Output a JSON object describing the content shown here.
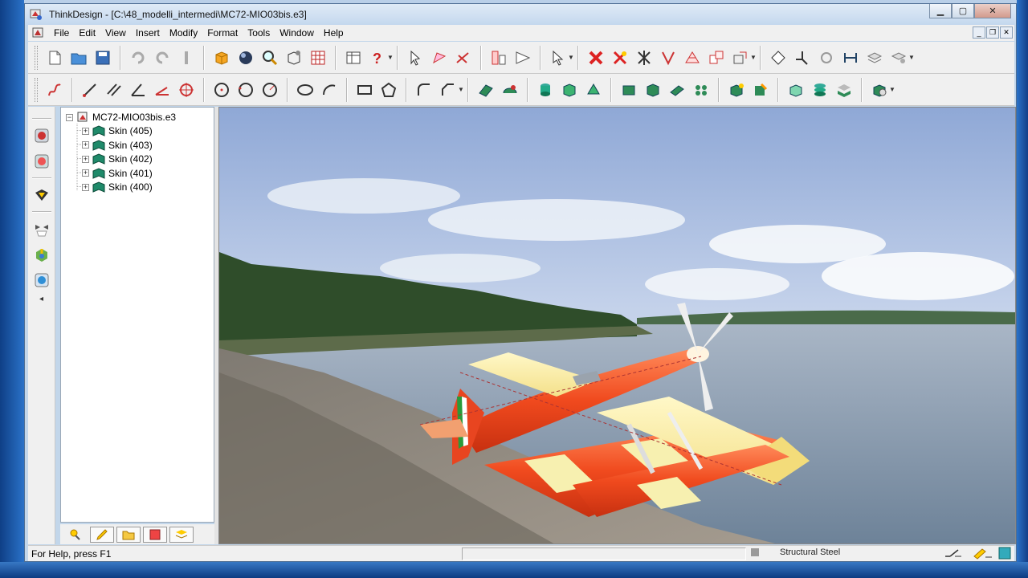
{
  "window": {
    "title": "ThinkDesign  - [C:\\48_modelli_intermedi\\MC72-MIO03bis.e3]"
  },
  "menubar": {
    "items": [
      {
        "label": "File"
      },
      {
        "label": "Edit"
      },
      {
        "label": "View"
      },
      {
        "label": "Insert"
      },
      {
        "label": "Modify"
      },
      {
        "label": "Format"
      },
      {
        "label": "Tools"
      },
      {
        "label": "Window"
      },
      {
        "label": "Help"
      }
    ]
  },
  "tree": {
    "root": "MC72-MIO03bis.e3",
    "items": [
      {
        "label": "Skin (405)"
      },
      {
        "label": "Skin (403)"
      },
      {
        "label": "Skin (402)"
      },
      {
        "label": "Skin (401)"
      },
      {
        "label": "Skin (400)"
      }
    ]
  },
  "statusbar": {
    "help": "For Help, press F1",
    "material": "Structural Steel"
  },
  "colors": {
    "accent": "#2a72c8",
    "model_red": "#f04a1e",
    "model_cream": "#f7f0b0"
  }
}
